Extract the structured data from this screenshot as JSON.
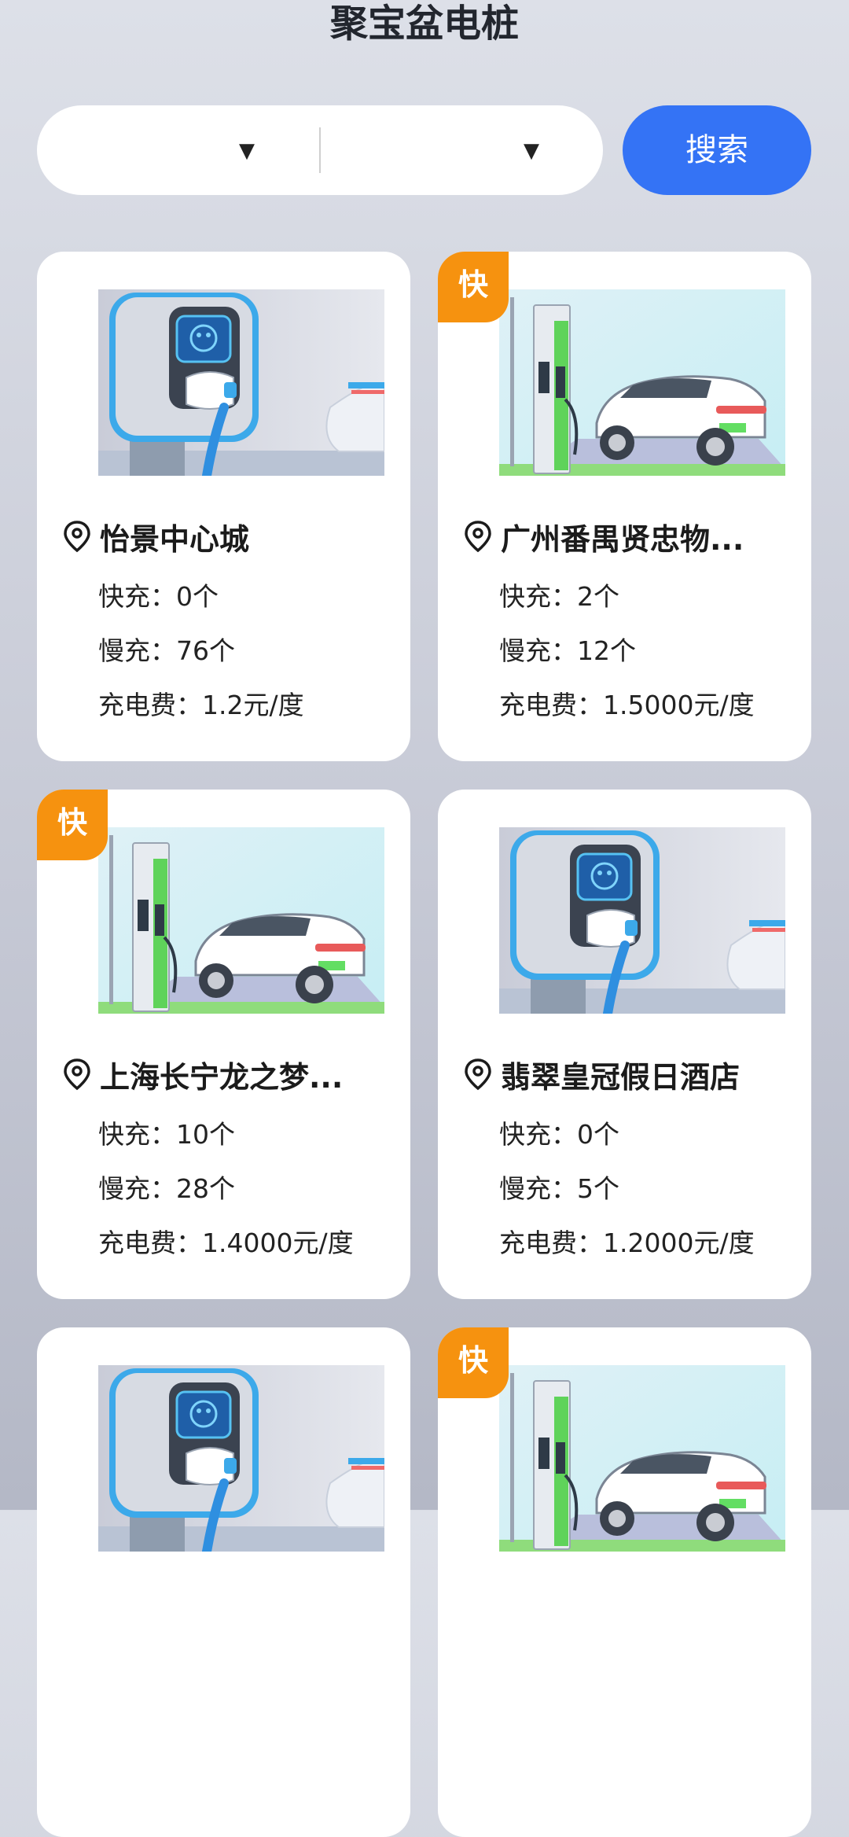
{
  "header": {
    "title": "聚宝盆电桩"
  },
  "search": {
    "select1_value": "",
    "select2_value": "",
    "button_label": "搜索"
  },
  "labels": {
    "fast": "快充：",
    "slow": "慢充：",
    "fee": "充电费：",
    "badge": "快"
  },
  "stations": [
    {
      "name": "怡景中心城",
      "fast": "0个",
      "slow": "76个",
      "fee": "1.2元/度",
      "fast_badge": false,
      "image": "wall-charger"
    },
    {
      "name": "广州番禺贤忠物...",
      "fast": "2个",
      "slow": "12个",
      "fee": "1.5000元/度",
      "fast_badge": true,
      "image": "pillar-charger-car"
    },
    {
      "name": "上海长宁龙之梦...",
      "fast": "10个",
      "slow": "28个",
      "fee": "1.4000元/度",
      "fast_badge": true,
      "image": "pillar-charger-car"
    },
    {
      "name": "翡翠皇冠假日酒店",
      "fast": "0个",
      "slow": "5个",
      "fee": "1.2000元/度",
      "fast_badge": false,
      "image": "wall-charger"
    },
    {
      "name": "",
      "fast": "",
      "slow": "",
      "fee": "",
      "fast_badge": false,
      "image": "wall-charger"
    },
    {
      "name": "",
      "fast": "",
      "slow": "",
      "fee": "",
      "fast_badge": true,
      "image": "pillar-charger-car"
    }
  ],
  "colors": {
    "accent": "#3473f5",
    "badge": "#f6920f"
  },
  "icons": {
    "pin": "location-pin-icon",
    "caret": "caret-down-icon"
  }
}
